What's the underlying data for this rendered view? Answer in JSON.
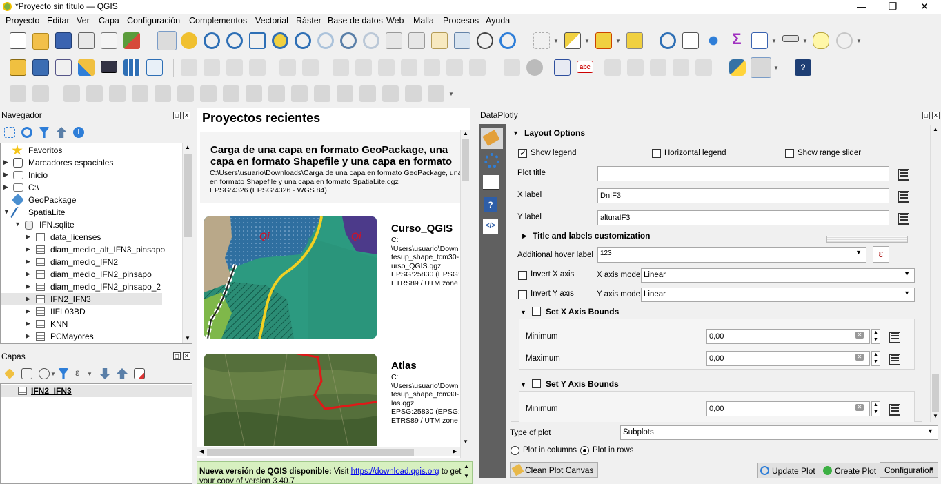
{
  "window": {
    "title": "*Proyecto sin título — QGIS",
    "min": "—",
    "max": "❐",
    "close": "✕"
  },
  "menu": [
    "Proyecto",
    "Editar",
    "Ver",
    "Capa",
    "Configuración",
    "Complementos",
    "Vectorial",
    "Ráster",
    "Base de datos",
    "Web",
    "Malla",
    "Procesos",
    "Ayuda"
  ],
  "navegador": {
    "title": "Navegador",
    "items": [
      "Favoritos",
      "Marcadores espaciales",
      "Inicio",
      "C:\\",
      "GeoPackage",
      "SpatiaLite",
      "IFN.sqlite",
      "data_licenses",
      "diam_medio_alt_IFN3_pinsapo",
      "diam_medio_IFN2",
      "diam_medio_IFN2_pinsapo",
      "diam_medio_IFN2_pinsapo_2",
      "IFN2_IFN3",
      "IIFL03BD",
      "KNN",
      "PCMayores"
    ]
  },
  "capas": {
    "title": "Capas",
    "layer": "IFN2_IFN3"
  },
  "recent": {
    "heading": "Proyectos recientes",
    "p1_title": "Carga de una capa en formato GeoPackage, una capa en formato Shapefile y una capa en formato SpatiaLite",
    "p1_path": "C:\\Users\\usuario\\Downloads\\Carga de una capa en formato GeoPackage, una capa\nen formato Shapefile y una capa en formato SpatiaLite.qgz",
    "p1_crs": "EPSG:4326 (EPSG:4326 - WGS 84)",
    "p2_title": "Curso_QGIS",
    "p2_txt": "C:\n\\Users\\usuario\\Down\ntesup_shape_tcm30-\nurso_QGIS.qgz\nEPSG:25830 (EPSG:2\nETRS89 / UTM zone 3",
    "p3_title": "Atlas",
    "p3_txt": "C:\n\\Users\\usuario\\Down\ntesup_shape_tcm30-\nlas.qgz\nEPSG:25830 (EPSG:2\nETRS89 / UTM zone 3",
    "map_label": "Qi",
    "news_bold": "Nueva versión de QGIS disponible:",
    "news_visit": "Visit",
    "news_link": "https://download.qgis.org",
    "news_tail": "to get",
    "news_line2": "your copy of version 3.40.7"
  },
  "dataplotly": {
    "title": "DataPlotly",
    "layout_options": "Layout Options",
    "show_legend": "Show legend",
    "horizontal_legend": "Horizontal legend",
    "show_range_slider": "Show range slider",
    "plot_title": "Plot title",
    "plot_title_value": "",
    "x_label": "X label",
    "x_label_value": "DnIF3",
    "y_label": "Y label",
    "y_label_value": "alturaIF3",
    "title_labels": "Title and labels customization",
    "hover_label": "Additional hover label",
    "hover_value": "123",
    "invert_x": "Invert X axis",
    "invert_y": "Invert Y axis",
    "x_axis_mode": "X axis mode",
    "y_axis_mode": "Y axis mode",
    "x_axis_mode_value": "Linear",
    "y_axis_mode_value": "Linear",
    "set_x_bounds": "Set X Axis Bounds",
    "set_y_bounds": "Set Y Axis Bounds",
    "minimum": "Minimum",
    "maximum": "Maximum",
    "x_min": "0,00",
    "x_max": "0,00",
    "y_min": "0,00",
    "type_of_plot": "Type of plot",
    "type_value": "Subplots",
    "plot_in_columns": "Plot in columns",
    "plot_in_rows": "Plot in rows",
    "clean": "Clean Plot Canvas",
    "update": "Update Plot",
    "create": "Create Plot",
    "configuration": "Configuration",
    "epsilon": "ε"
  },
  "colors": {
    "accent": "#2e7ed8",
    "link": "#0000ee",
    "news_bg": "#d7f0c0"
  }
}
